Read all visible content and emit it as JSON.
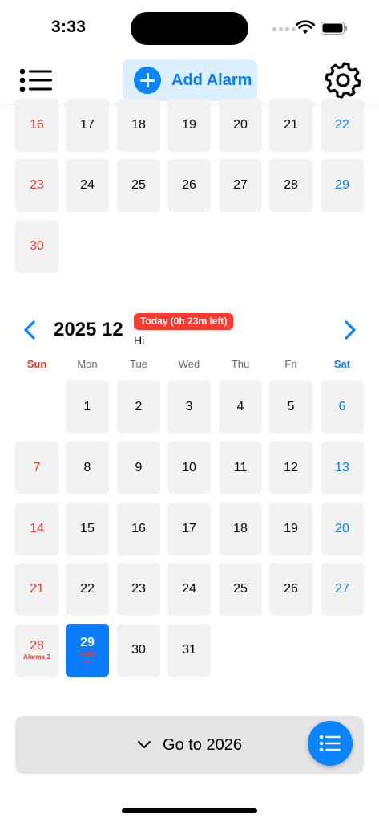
{
  "status_bar": {
    "time": "3:33"
  },
  "toolbar": {
    "add_alarm_label": "Add Alarm"
  },
  "prev_month_tail": {
    "rows": [
      [
        "16",
        "17",
        "18",
        "19",
        "20",
        "21",
        "22"
      ],
      [
        "23",
        "24",
        "25",
        "26",
        "27",
        "28",
        "29"
      ],
      [
        "30"
      ]
    ]
  },
  "month": {
    "title": "2025 12",
    "today_badge": "Today (0h 23m left)",
    "note": "Hi",
    "weekdays": [
      "Sun",
      "Mon",
      "Tue",
      "Wed",
      "Thu",
      "Fri",
      "Sat"
    ],
    "first_weekday": 1,
    "days": [
      "1",
      "2",
      "3",
      "4",
      "5",
      "6",
      "7",
      "8",
      "9",
      "10",
      "11",
      "12",
      "13",
      "14",
      "15",
      "16",
      "17",
      "18",
      "19",
      "20",
      "21",
      "22",
      "23",
      "24",
      "25",
      "26",
      "27",
      "28",
      "29",
      "30",
      "31"
    ],
    "day28_label": "Alarms 2",
    "today_day": "29",
    "today_label": "Today",
    "today_note": "Hi"
  },
  "bottom": {
    "goto_label": "Go to 2026"
  },
  "colors": {
    "accent": "#0a84ff",
    "sunday": "#ee3b30",
    "saturday": "#0a7aff",
    "badge": "#ff3b30"
  }
}
